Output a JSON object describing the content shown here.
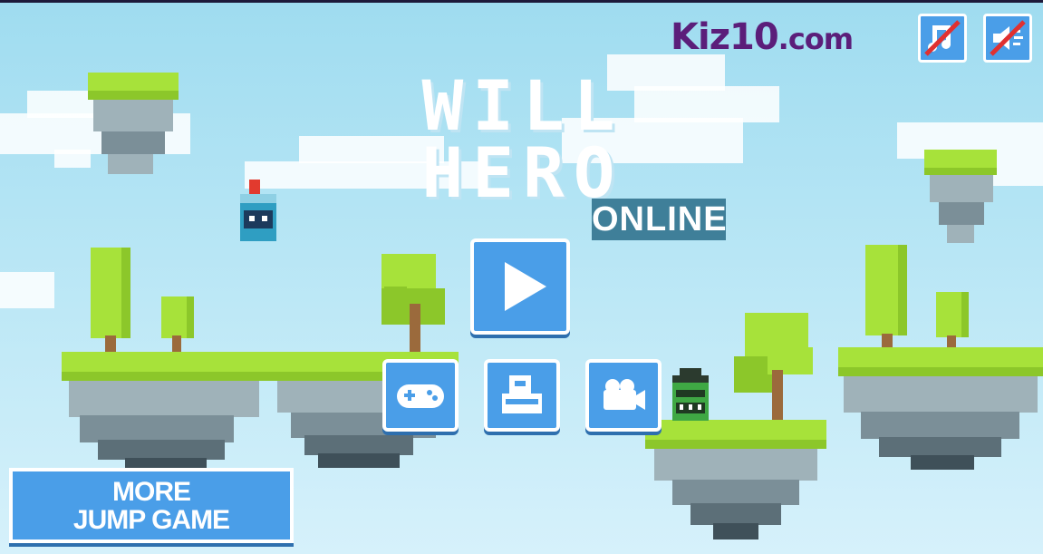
{
  "logo": {
    "main": "Kiz10",
    "sub": ".com"
  },
  "title": {
    "line1": "WILL",
    "line2": "HERO",
    "tag": "ONLINE"
  },
  "more_button": {
    "line1": "MORE",
    "line2": "JUMP GAME"
  },
  "icons": {
    "music": "music-off-icon",
    "sound": "sound-off-icon",
    "play": "play-icon",
    "gamepad": "gamepad-icon",
    "character": "character-shop-icon",
    "video": "video-camera-icon"
  },
  "colors": {
    "sky": "#9fdcf0",
    "button": "#4a9ee8",
    "brand": "#5b1e7a",
    "grass": "#a7e23a",
    "title_tag": "#3f7f99"
  }
}
